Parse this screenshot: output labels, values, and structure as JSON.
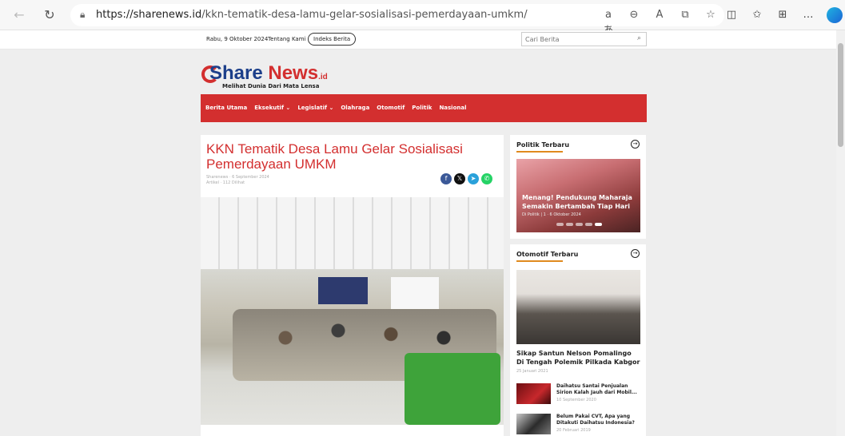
{
  "browser": {
    "url_domain": "https://sharenews.id",
    "url_path": "/kkn-tematik-desa-lamu-gelar-sosialisasi-pemerdayaan-umkm/"
  },
  "topbar": {
    "date": "Rabu, 9 Oktober 2024",
    "about": "Tentang Kami",
    "index": "Indeks Berita",
    "search_placeholder": "Cari Berita"
  },
  "logo": {
    "word1": "Share",
    "word2": "News",
    "suffix": ".id",
    "tagline": "Melihat Dunia Dari Mata Lensa"
  },
  "menu": [
    "Berita Utama",
    "Eksekutif ⌄",
    "Legislatif ⌄",
    "Olahraga",
    "Otomotif",
    "Politik",
    "Nasional"
  ],
  "article": {
    "title": "KKN Tematik Desa Lamu Gelar Sosialisasi Pemerdayaan UMKM",
    "meta_author_date": "Sharenews · 6 September 2024",
    "meta_category_views": "Artikel · 112 Dilihat"
  },
  "share_icons": [
    "f",
    "𝕏",
    "➤",
    "✆"
  ],
  "politik": {
    "heading": "Politik Terbaru",
    "slide_title": "Menang! Pendukung Maharaja Semakin Bertambah Tiap Hari",
    "slide_meta": "Di Politik | 1 · 6 Oktober 2024"
  },
  "otomotif": {
    "heading": "Otomotif Terbaru",
    "featured_title": "Sikap Santun Nelson Pomalingo Di Tengah Polemik Pilkada Kabgor",
    "featured_date": "25 Januari 2021",
    "items": [
      {
        "title": "Daihatsu Santai Penjualan Sirion Kalah Jauh dari Mobil...",
        "date": "10 September 2020"
      },
      {
        "title": "Belum Pakai CVT, Apa yang Ditakuti Daihatsu Indonesia?",
        "date": "20 Februari 2019"
      }
    ]
  },
  "colors": {
    "brand_red": "#d32f2f",
    "brand_blue": "#1c3f8a",
    "accent_orange": "#e08a1e"
  }
}
